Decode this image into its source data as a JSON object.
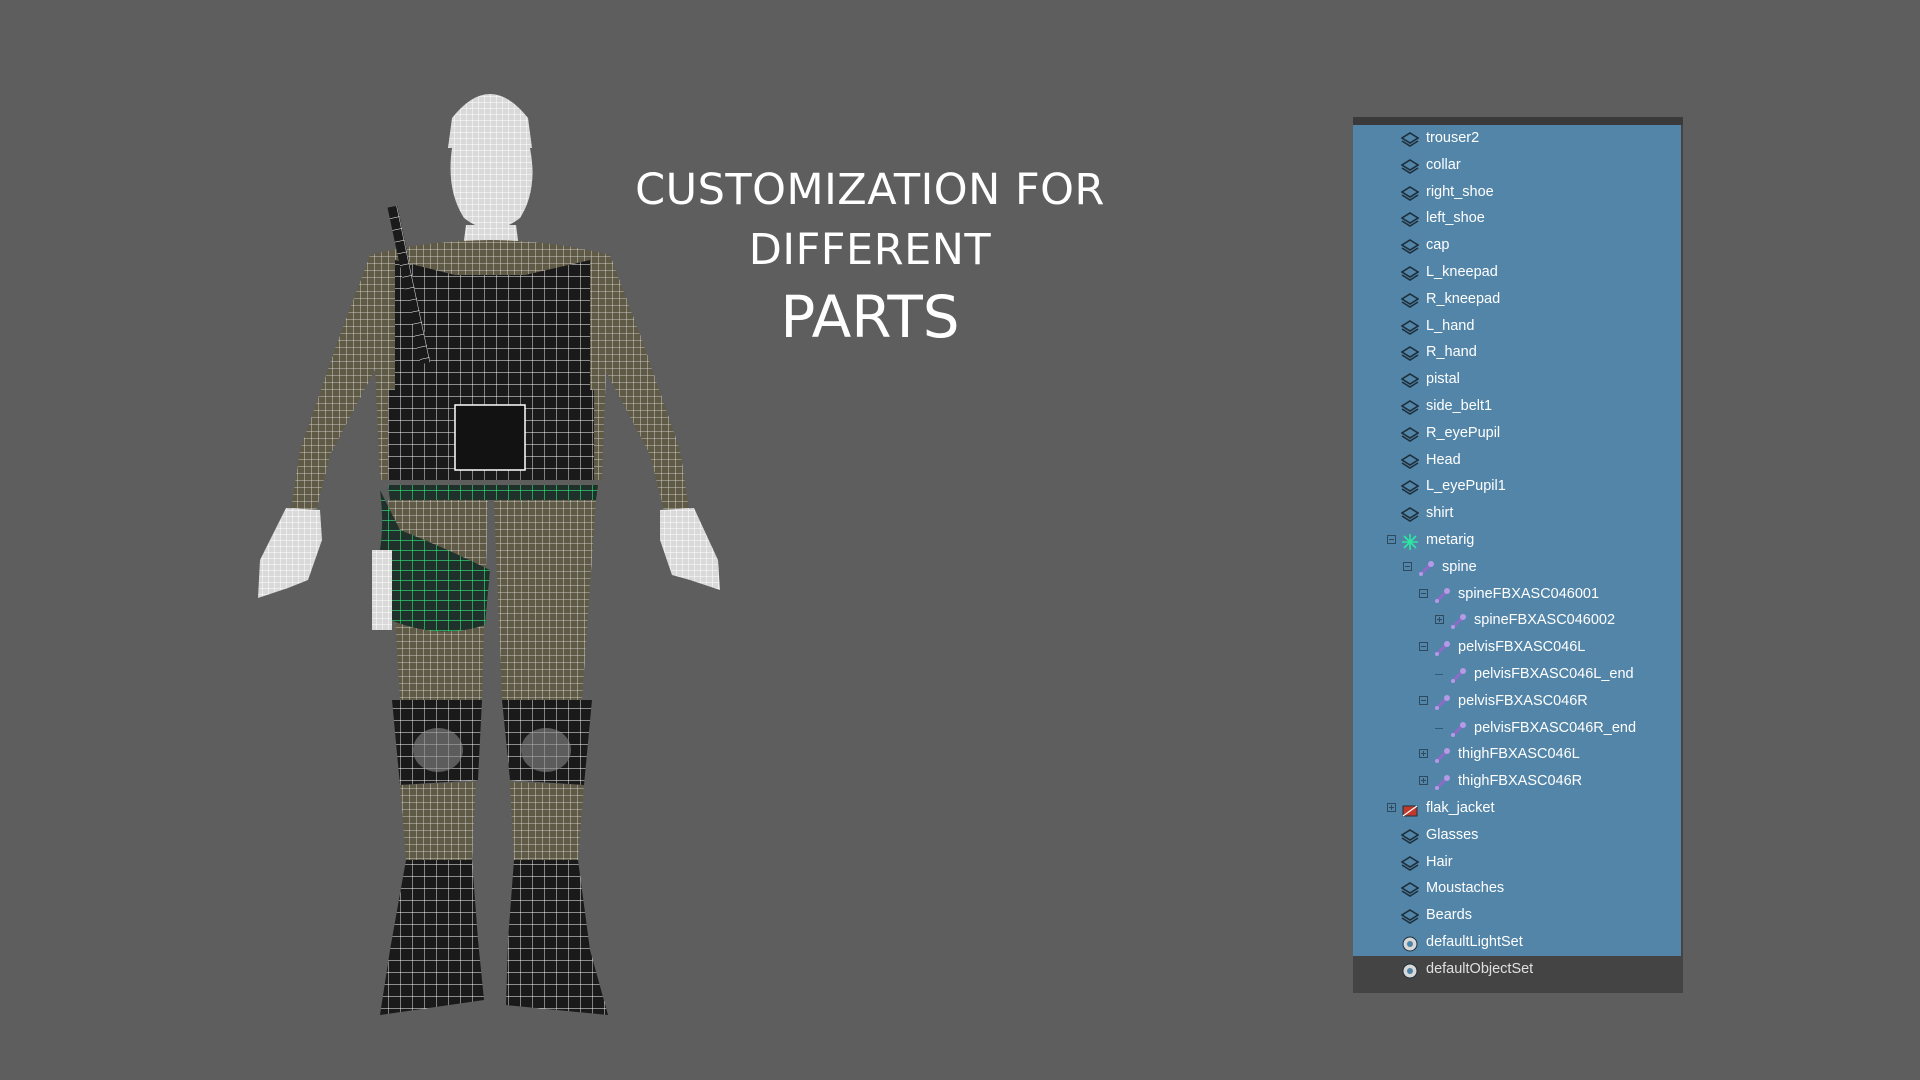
{
  "headline": {
    "line1": "CUSTOMIZATION FOR DIFFERENT",
    "line2": "PARTS"
  },
  "viewport": {
    "wire_color": "#ffffff",
    "highlight_color": "#2ee87a",
    "camo_color": "#5f5a46",
    "gear_color": "#1a1a1a"
  },
  "outliner": {
    "selection_color": "#5285a8",
    "background_color": "#444444",
    "items": [
      {
        "label": "trouser2",
        "icon": "mesh-icon",
        "depth": 0
      },
      {
        "label": "collar",
        "icon": "mesh-icon",
        "depth": 0
      },
      {
        "label": "right_shoe",
        "icon": "mesh-icon",
        "depth": 0
      },
      {
        "label": "left_shoe",
        "icon": "mesh-icon",
        "depth": 0
      },
      {
        "label": "cap",
        "icon": "mesh-icon",
        "depth": 0
      },
      {
        "label": "L_kneepad",
        "icon": "mesh-icon",
        "depth": 0
      },
      {
        "label": "R_kneepad",
        "icon": "mesh-icon",
        "depth": 0
      },
      {
        "label": "L_hand",
        "icon": "mesh-icon",
        "depth": 0
      },
      {
        "label": "R_hand",
        "icon": "mesh-icon",
        "depth": 0
      },
      {
        "label": "pistal",
        "icon": "mesh-icon",
        "depth": 0
      },
      {
        "label": "side_belt1",
        "icon": "mesh-icon",
        "depth": 0
      },
      {
        "label": "R_eyePupil",
        "icon": "mesh-icon",
        "depth": 0
      },
      {
        "label": "Head",
        "icon": "mesh-icon",
        "depth": 0
      },
      {
        "label": "L_eyePupil1",
        "icon": "mesh-icon",
        "depth": 0
      },
      {
        "label": "shirt",
        "icon": "mesh-icon",
        "depth": 0
      },
      {
        "label": "metarig",
        "icon": "skeleton-root-icon",
        "depth": 0,
        "expander": "minus"
      },
      {
        "label": "spine",
        "icon": "joint-icon",
        "depth": 1,
        "expander": "minus"
      },
      {
        "label": "spineFBXASC046001",
        "icon": "joint-icon",
        "depth": 2,
        "expander": "minus"
      },
      {
        "label": "spineFBXASC046002",
        "icon": "joint-icon",
        "depth": 3,
        "expander": "plus"
      },
      {
        "label": "pelvisFBXASC046L",
        "icon": "joint-icon",
        "depth": 2,
        "expander": "minus"
      },
      {
        "label": "pelvisFBXASC046L_end",
        "icon": "joint-icon",
        "depth": 3,
        "expander": "leaf"
      },
      {
        "label": "pelvisFBXASC046R",
        "icon": "joint-icon",
        "depth": 2,
        "expander": "minus"
      },
      {
        "label": "pelvisFBXASC046R_end",
        "icon": "joint-icon",
        "depth": 3,
        "expander": "leaf"
      },
      {
        "label": "thighFBXASC046L",
        "icon": "joint-icon",
        "depth": 2,
        "expander": "plus"
      },
      {
        "label": "thighFBXASC046R",
        "icon": "joint-icon",
        "depth": 2,
        "expander": "plus"
      },
      {
        "label": "flak_jacket",
        "icon": "group-icon",
        "depth": 0,
        "expander": "plus"
      },
      {
        "label": "Glasses",
        "icon": "mesh-icon",
        "depth": 0
      },
      {
        "label": "Hair",
        "icon": "mesh-icon",
        "depth": 0
      },
      {
        "label": "Moustaches",
        "icon": "mesh-icon",
        "depth": 0
      },
      {
        "label": "Beards",
        "icon": "mesh-icon",
        "depth": 0
      },
      {
        "label": "defaultLightSet",
        "icon": "set-icon",
        "depth": 0
      },
      {
        "label": "defaultObjectSet",
        "icon": "set-icon",
        "depth": 0,
        "selected": false
      }
    ]
  }
}
